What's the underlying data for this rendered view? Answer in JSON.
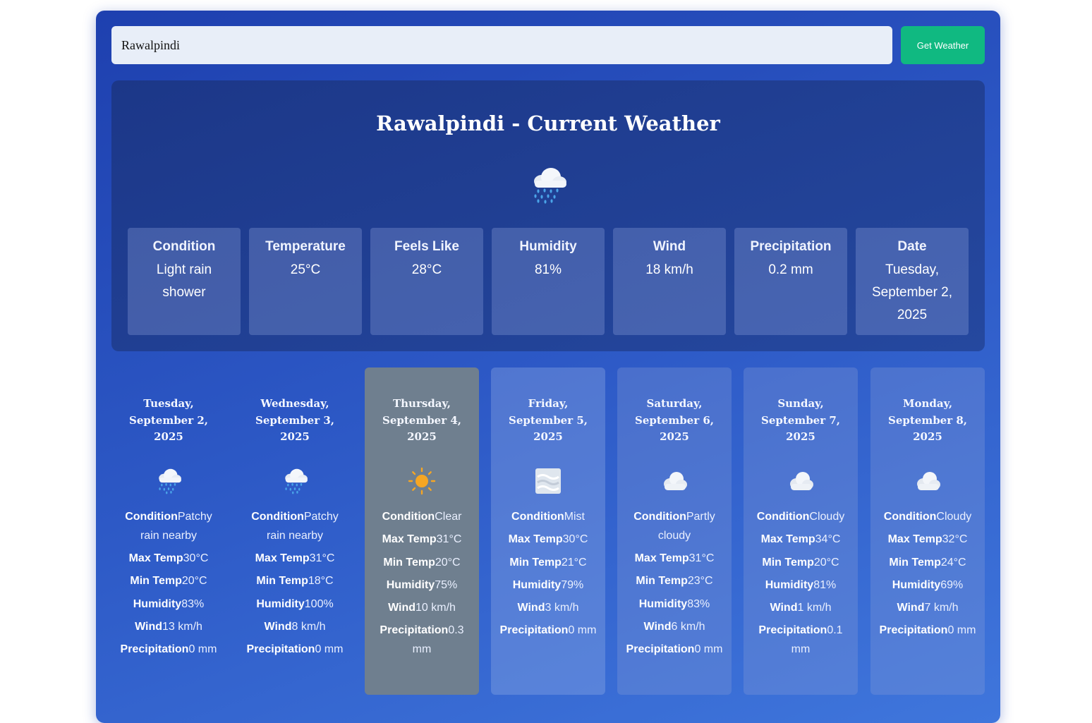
{
  "search": {
    "value": "Rawalpindi",
    "button_label": "Get Weather"
  },
  "current": {
    "title": "Rawalpindi - Current Weather",
    "icon": "rain-cloud-icon",
    "stats": [
      {
        "label": "Condition",
        "value": "Light rain shower"
      },
      {
        "label": "Temperature",
        "value": "25°C"
      },
      {
        "label": "Feels Like",
        "value": "28°C"
      },
      {
        "label": "Humidity",
        "value": "81%"
      },
      {
        "label": "Wind",
        "value": "18 km/h"
      },
      {
        "label": "Precipitation",
        "value": "0.2 mm"
      },
      {
        "label": "Date",
        "value": "Tuesday, September 2, 2025"
      }
    ]
  },
  "labels": {
    "condition": "Condition",
    "max_temp": "Max Temp",
    "min_temp": "Min Temp",
    "humidity": "Humidity",
    "wind": "Wind",
    "precipitation": "Precipitation"
  },
  "forecast": [
    {
      "date": "Tuesday, September 2, 2025",
      "icon": "rain-cloud-icon",
      "condition": "Patchy rain nearby",
      "max_temp": "30°C",
      "min_temp": "20°C",
      "humidity": "83%",
      "wind": "13 km/h",
      "precipitation": "0 mm"
    },
    {
      "date": "Wednesday, September 3, 2025",
      "icon": "rain-cloud-icon",
      "condition": "Patchy rain nearby",
      "max_temp": "31°C",
      "min_temp": "18°C",
      "humidity": "100%",
      "wind": "8 km/h",
      "precipitation": "0 mm"
    },
    {
      "date": "Thursday, September 4, 2025",
      "icon": "sun-icon",
      "condition": "Clear",
      "max_temp": "31°C",
      "min_temp": "20°C",
      "humidity": "75%",
      "wind": "10 km/h",
      "precipitation": "0.3 mm"
    },
    {
      "date": "Friday, September 5, 2025",
      "icon": "mist-icon",
      "condition": "Mist",
      "max_temp": "30°C",
      "min_temp": "21°C",
      "humidity": "79%",
      "wind": "3 km/h",
      "precipitation": "0 mm"
    },
    {
      "date": "Saturday, September 6, 2025",
      "icon": "cloud-icon",
      "condition": "Partly cloudy",
      "max_temp": "31°C",
      "min_temp": "23°C",
      "humidity": "83%",
      "wind": "6 km/h",
      "precipitation": "0 mm"
    },
    {
      "date": "Sunday, September 7, 2025",
      "icon": "cloud-icon",
      "condition": "Cloudy",
      "max_temp": "34°C",
      "min_temp": "20°C",
      "humidity": "81%",
      "wind": "1 km/h",
      "precipitation": "0.1 mm"
    },
    {
      "date": "Monday, September 8, 2025",
      "icon": "cloud-icon",
      "condition": "Cloudy",
      "max_temp": "32°C",
      "min_temp": "24°C",
      "humidity": "69%",
      "wind": "7 km/h",
      "precipitation": "0 mm"
    }
  ],
  "colors": {
    "accent": "#10b981",
    "panel_start": "#1e40af",
    "panel_end": "#3f76dc",
    "highlight_card": "#6f7f8f"
  }
}
